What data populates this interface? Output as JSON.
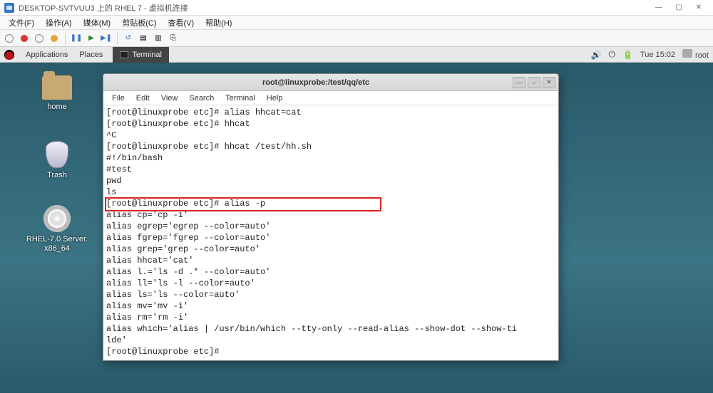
{
  "vm": {
    "title": "DESKTOP-SVTVUU3 上的 RHEL 7 - 虚拟机连接",
    "menus": {
      "file": "文件(F)",
      "action": "操作(A)",
      "media": "媒体(M)",
      "clipboard": "剪贴板(C)",
      "view": "查看(V)",
      "help": "帮助(H)"
    },
    "win_min": "—",
    "win_max": "▢",
    "win_close": "✕"
  },
  "gnome": {
    "applications": "Applications",
    "places": "Places",
    "task_terminal": "Terminal",
    "time": "Tue 15:02",
    "root": "root"
  },
  "desktop": {
    "home": "home",
    "trash": "Trash",
    "cd_line1": "RHEL-7.0 Server.",
    "cd_line2": "x86_64"
  },
  "terminal": {
    "title": "root@linuxprobe:/test/qq/etc",
    "menus": {
      "file": "File",
      "edit": "Edit",
      "view": "View",
      "search": "Search",
      "terminal": "Terminal",
      "help": "Help"
    },
    "win_min": "—",
    "win_max": "▫",
    "win_close": "✕",
    "lines": {
      "l0": "[root@linuxprobe etc]# alias hhcat=cat",
      "l1": "[root@linuxprobe etc]# hhcat",
      "l2": "^C",
      "l3": "[root@linuxprobe etc]# hhcat /test/hh.sh",
      "l4": "#!/bin/bash",
      "l5": "#test",
      "l6": "pwd",
      "l7": "ls",
      "l8": "[root@linuxprobe etc]# alias -p",
      "l9": "alias cp='cp -i'",
      "l10": "alias egrep='egrep --color=auto'",
      "l11": "alias fgrep='fgrep --color=auto'",
      "l12": "alias grep='grep --color=auto'",
      "l13": "alias hhcat='cat'",
      "l14": "alias l.='ls -d .* --color=auto'",
      "l15": "alias ll='ls -l --color=auto'",
      "l16": "alias ls='ls --color=auto'",
      "l17": "alias mv='mv -i'",
      "l18": "alias rm='rm -i'",
      "l19": "alias which='alias | /usr/bin/which --tty-only --read-alias --show-dot --show-ti",
      "l20": "lde'",
      "l21": "[root@linuxprobe etc]# "
    }
  }
}
